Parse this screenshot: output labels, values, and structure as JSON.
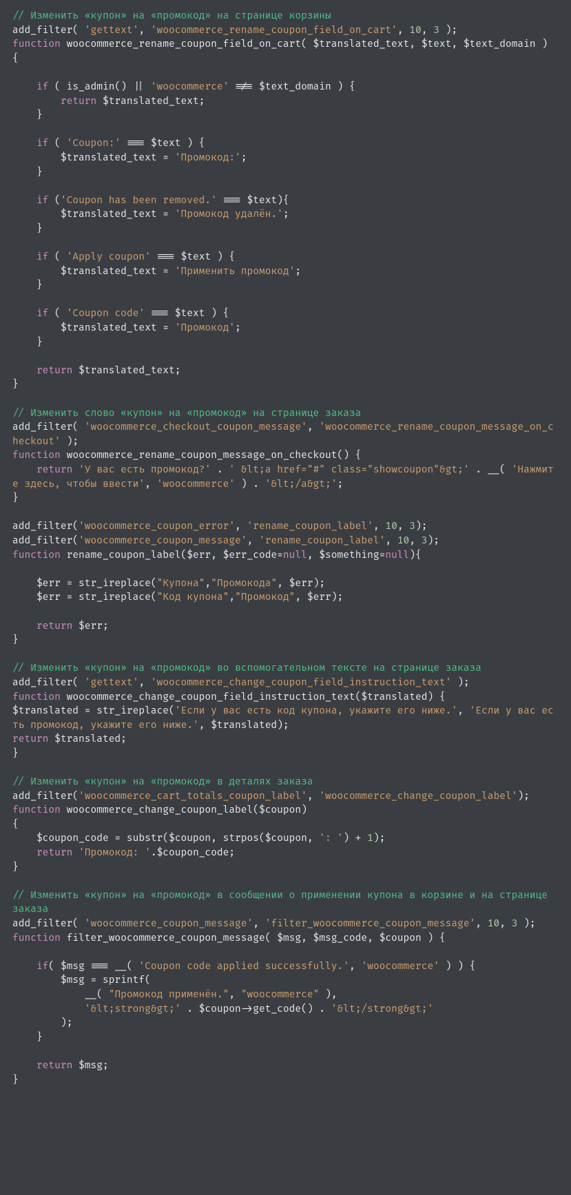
{
  "code": {
    "c1": "// Изменить «купон» на «промокод» на странице корзины",
    "l2": "add_filter( 'gettext', 'woocommerce_rename_coupon_field_on_cart', 10, 3 );",
    "l3": "function woocommerce_rename_coupon_field_on_cart( $translated_text, $text, $text_domain ) {",
    "l4": "",
    "l5": "    if ( is_admin() || 'woocommerce' !== $text_domain ) {",
    "l6": "        return $translated_text;",
    "l7": "    }",
    "l8": "",
    "l9": "    if ( 'Coupon:' === $text ) {",
    "l10": "        $translated_text = 'Промокод:';",
    "l11": "    }",
    "l12": "",
    "l13": "    if ('Coupon has been removed.' === $text){",
    "l14": "        $translated_text = 'Промокод удалён.';",
    "l15": "    }",
    "l16": "",
    "l17": "    if ( 'Apply coupon' === $text ) {",
    "l18": "        $translated_text = 'Применить промокод';",
    "l19": "    }",
    "l20": "",
    "l21": "    if ( 'Coupon code' === $text ) {",
    "l22": "        $translated_text = 'Промокод';",
    "l23": "    }",
    "l24": "",
    "l25": "    return $translated_text;",
    "l26": "}",
    "l27": "",
    "c2": "// Изменить слово «купон» на «промокод» на странице заказа",
    "l29": "add_filter( 'woocommerce_checkout_coupon_message', 'woocommerce_rename_coupon_message_on_checkout' );",
    "l30": "function woocommerce_rename_coupon_message_on_checkout() {",
    "l31": "    return 'У вас есть промокод?' . ' <a href=\"#\" class=\"showcoupon\">' . __( 'Нажмите здесь, чтобы ввести', 'woocommerce' ) . '</a>';",
    "l32": "}",
    "l33": "",
    "l34": "add_filter('woocommerce_coupon_error', 'rename_coupon_label', 10, 3);",
    "l35": "add_filter('woocommerce_coupon_message', 'rename_coupon_label', 10, 3);",
    "l36": "function rename_coupon_label($err, $err_code=null, $something=null){",
    "l37": "",
    "l38": "    $err = str_ireplace(\"Купона\",\"Промокода\", $err);",
    "l39": "    $err = str_ireplace(\"Код купона\",\"Промокод\", $err);",
    "l40": "",
    "l41": "    return $err;",
    "l42": "}",
    "l43": "",
    "c3": "// Изменить «купон» на «промокод» во вспомогательном тексте на странице заказа",
    "l45": "add_filter( 'gettext', 'woocommerce_change_coupon_field_instruction_text' );",
    "l46": "function woocommerce_change_coupon_field_instruction_text($translated) {",
    "l47": "$translated = str_ireplace('Если у вас есть код купона, укажите его ниже.', 'Если у вас есть промокод, укажите его ниже.', $translated);",
    "l48": "return $translated;",
    "l49": "}",
    "l50": "",
    "c4": "// Изменить «купон» на «промокод» в деталях заказа",
    "l52": "add_filter('woocommerce_cart_totals_coupon_label', 'woocommerce_change_coupon_label');",
    "l53": "function woocommerce_change_coupon_label($coupon)",
    "l54": "{",
    "l55": "    $coupon_code = substr($coupon, strpos($coupon, ': ') + 1);",
    "l56": "    return 'Промокод: '.$coupon_code;",
    "l57": "}",
    "l58": "",
    "c5": "// Изменить «купон» на «промокод» в сообщении о применении купона в корзине и на странице заказа",
    "l60": "add_filter( 'woocommerce_coupon_message', 'filter_woocommerce_coupon_message', 10, 3 );",
    "l61": "function filter_woocommerce_coupon_message( $msg, $msg_code, $coupon ) {",
    "l62": "",
    "l63": "    if( $msg === __( 'Coupon code applied successfully.', 'woocommerce' ) ) {",
    "l64": "        $msg = sprintf(",
    "l65": "            __( \"Промокод применён.\", \"woocommerce\" ),",
    "l66": "            '<strong>' . $coupon->get_code() . '</strong>'",
    "l67": "        );",
    "l68": "    }",
    "l69": "",
    "l70": "    return $msg;",
    "l71": "}"
  }
}
